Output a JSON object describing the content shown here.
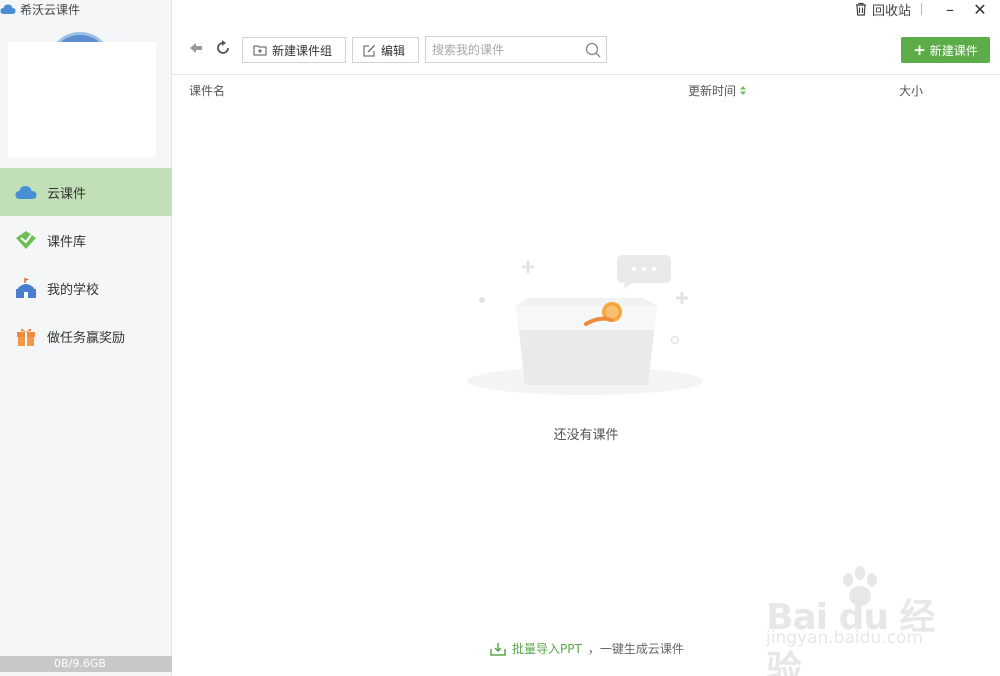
{
  "app": {
    "title": "希沃云课件"
  },
  "window": {
    "recycle_label": "回收站",
    "minimize_glyph": "–",
    "close_glyph": "✕"
  },
  "sidebar": {
    "items": [
      {
        "label": "云课件",
        "icon": "cloud-icon",
        "active": true
      },
      {
        "label": "课件库",
        "icon": "library-icon",
        "active": false
      },
      {
        "label": "我的学校",
        "icon": "school-icon",
        "active": false
      },
      {
        "label": "做任务赢奖励",
        "icon": "gift-icon",
        "active": false
      }
    ],
    "storage": "0B/9.6GB"
  },
  "toolbar": {
    "new_group_label": "新建课件组",
    "edit_label": "编辑",
    "search_placeholder": "搜索我的课件",
    "new_course_label": "新建课件"
  },
  "table": {
    "columns": {
      "name": "课件名",
      "time": "更新时间",
      "size": "大小"
    }
  },
  "empty_state": {
    "message": "还没有课件"
  },
  "footer": {
    "link_label": "批量导入PPT",
    "suffix": "，一键生成云课件"
  },
  "watermark": {
    "brand": "Bai du 经验",
    "site": "jingyan.baidu.com"
  },
  "colors": {
    "accent": "#5cad4a",
    "active_nav": "#c2e0b8",
    "sidebar_bg": "#f5f6f7"
  }
}
